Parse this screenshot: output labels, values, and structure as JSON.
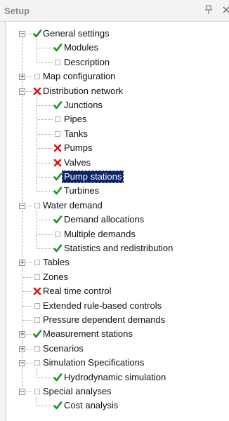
{
  "panel": {
    "title": "Setup",
    "pin_icon": "pin-icon",
    "close_icon": "close-icon"
  },
  "colors": {
    "check": "#1e8f1e",
    "cross": "#e01010",
    "unchecked": "#b0b0b0",
    "selection": "#0a246a"
  },
  "tree": [
    {
      "label": "General settings",
      "status": "check",
      "level": 0,
      "expander": "minus"
    },
    {
      "label": "Modules",
      "status": "check",
      "level": 1
    },
    {
      "label": "Description",
      "status": "empty",
      "level": 1
    },
    {
      "label": "Map configuration",
      "status": "empty",
      "level": 0,
      "expander": "plus"
    },
    {
      "label": "Distribution network",
      "status": "cross",
      "level": 0,
      "expander": "minus"
    },
    {
      "label": "Junctions",
      "status": "check",
      "level": 1
    },
    {
      "label": "Pipes",
      "status": "empty",
      "level": 1
    },
    {
      "label": "Tanks",
      "status": "empty",
      "level": 1
    },
    {
      "label": "Pumps",
      "status": "cross",
      "level": 1
    },
    {
      "label": "Valves",
      "status": "cross",
      "level": 1
    },
    {
      "label": "Pump stations",
      "status": "check",
      "level": 1,
      "selected": true
    },
    {
      "label": "Turbines",
      "status": "check",
      "level": 1
    },
    {
      "label": "Water demand",
      "status": "empty",
      "level": 0,
      "expander": "minus"
    },
    {
      "label": "Demand allocations",
      "status": "check",
      "level": 1
    },
    {
      "label": "Multiple demands",
      "status": "empty",
      "level": 1
    },
    {
      "label": "Statistics and redistribution",
      "status": "check",
      "level": 1
    },
    {
      "label": "Tables",
      "status": "empty",
      "level": 0,
      "expander": "plus"
    },
    {
      "label": "Zones",
      "status": "empty",
      "level": 0
    },
    {
      "label": "Real time control",
      "status": "cross",
      "level": 0
    },
    {
      "label": "Extended rule-based controls",
      "status": "empty",
      "level": 0
    },
    {
      "label": "Pressure dependent demands",
      "status": "empty",
      "level": 0
    },
    {
      "label": "Measurement stations",
      "status": "check",
      "level": 0,
      "expander": "plus"
    },
    {
      "label": "Scenarios",
      "status": "empty",
      "level": 0,
      "expander": "plus"
    },
    {
      "label": "Simulation Specifications",
      "status": "empty",
      "level": 0,
      "expander": "minus"
    },
    {
      "label": "Hydrodynamic simulation",
      "status": "check",
      "level": 1
    },
    {
      "label": "Special analyses",
      "status": "empty",
      "level": 0,
      "expander": "minus"
    },
    {
      "label": "Cost analysis",
      "status": "check",
      "level": 1
    }
  ]
}
